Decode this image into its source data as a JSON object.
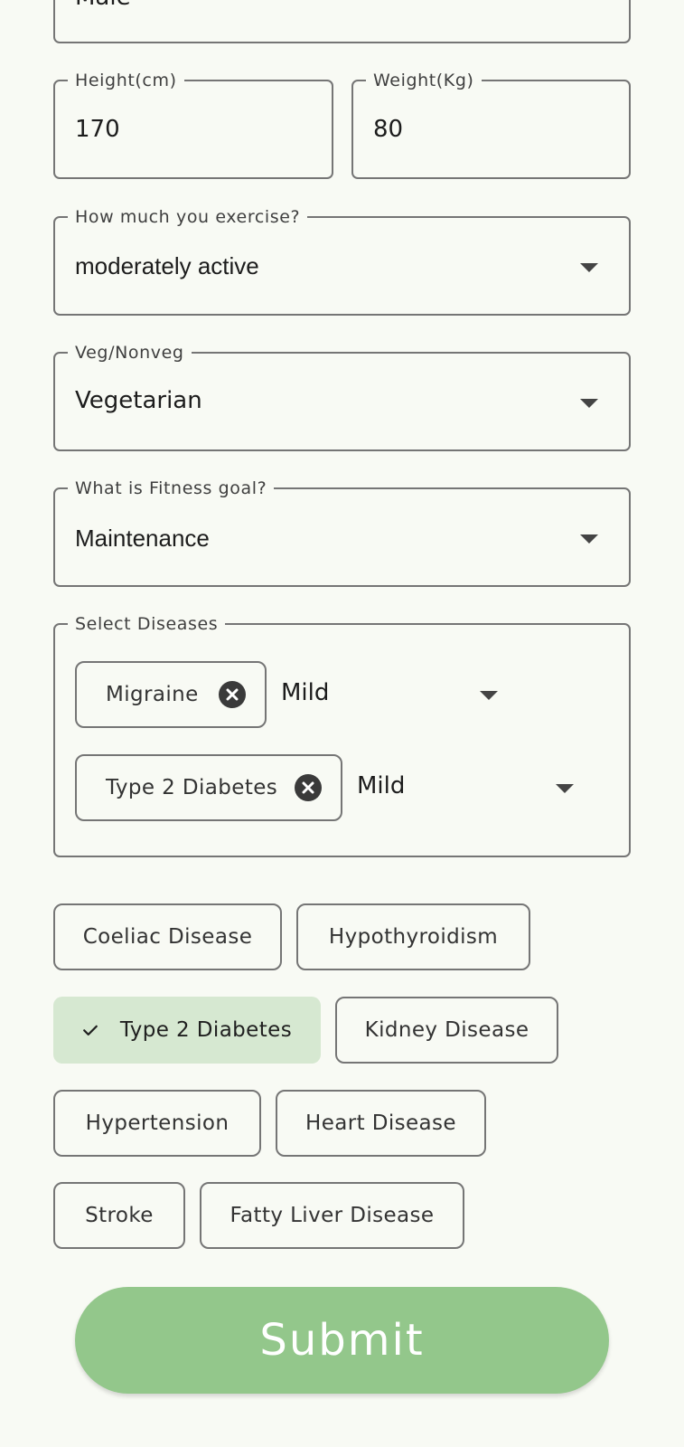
{
  "colors": {
    "background": "#f8faf4",
    "outline": "#757575",
    "selected_chip_bg": "#d6e8d1",
    "submit_bg": "#93c78b",
    "submit_text": "#ffffff"
  },
  "gender": {
    "value": "Male"
  },
  "height": {
    "label": "Height(cm)",
    "value": "170"
  },
  "weight": {
    "label": "Weight(Kg)",
    "value": "80"
  },
  "exercise": {
    "label": "How much you exercise?",
    "value": "moderately active",
    "icon": "dropdown-arrow-icon"
  },
  "diet": {
    "label": "Veg/Nonveg",
    "value": "Vegetarian",
    "icon": "dropdown-arrow-icon"
  },
  "goal": {
    "label": "What is Fitness goal?",
    "value": "Maintenance",
    "icon": "dropdown-arrow-icon"
  },
  "diseases": {
    "label": "Select Diseases",
    "selected": [
      {
        "name": "Migraine",
        "severity": "Mild",
        "remove_icon": "close-circle-icon"
      },
      {
        "name": "Type 2 Diabetes",
        "severity": "Mild",
        "remove_icon": "close-circle-icon"
      }
    ]
  },
  "disease_chips": [
    {
      "label": "Coeliac Disease",
      "selected": false
    },
    {
      "label": "Hypothyroidism",
      "selected": false
    },
    {
      "label": "Type 2 Diabetes",
      "selected": true,
      "icon": "check-icon"
    },
    {
      "label": "Kidney Disease",
      "selected": false
    },
    {
      "label": "Hypertension",
      "selected": false
    },
    {
      "label": "Heart Disease",
      "selected": false
    },
    {
      "label": "Stroke",
      "selected": false
    },
    {
      "label": "Fatty Liver Disease",
      "selected": false
    }
  ],
  "submit": {
    "label": "Submit"
  }
}
